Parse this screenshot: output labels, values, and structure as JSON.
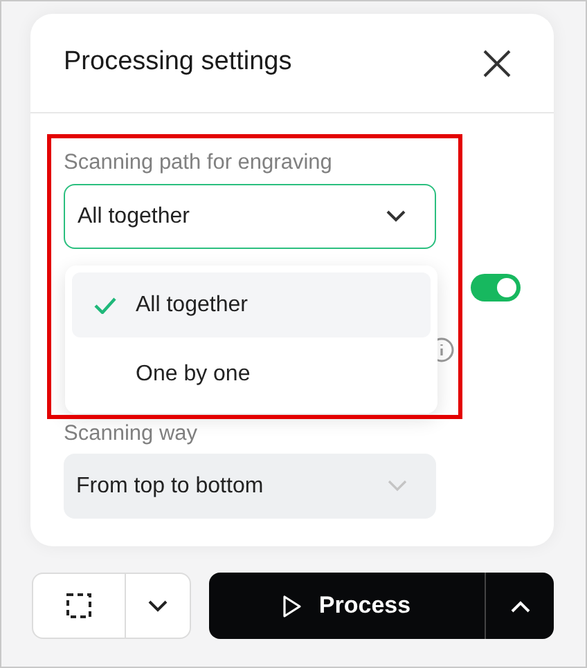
{
  "panel": {
    "title": "Processing settings"
  },
  "scanning_path": {
    "label": "Scanning path for engraving",
    "value": "All together",
    "expanded": true,
    "options": [
      {
        "label": "All together",
        "selected": true
      },
      {
        "label": "One by one",
        "selected": false
      }
    ]
  },
  "toggle": {
    "on": true
  },
  "scanning_way": {
    "label": "Scanning way",
    "value": "From top to bottom",
    "disabled": true
  },
  "footer": {
    "process_button": "Process"
  }
}
